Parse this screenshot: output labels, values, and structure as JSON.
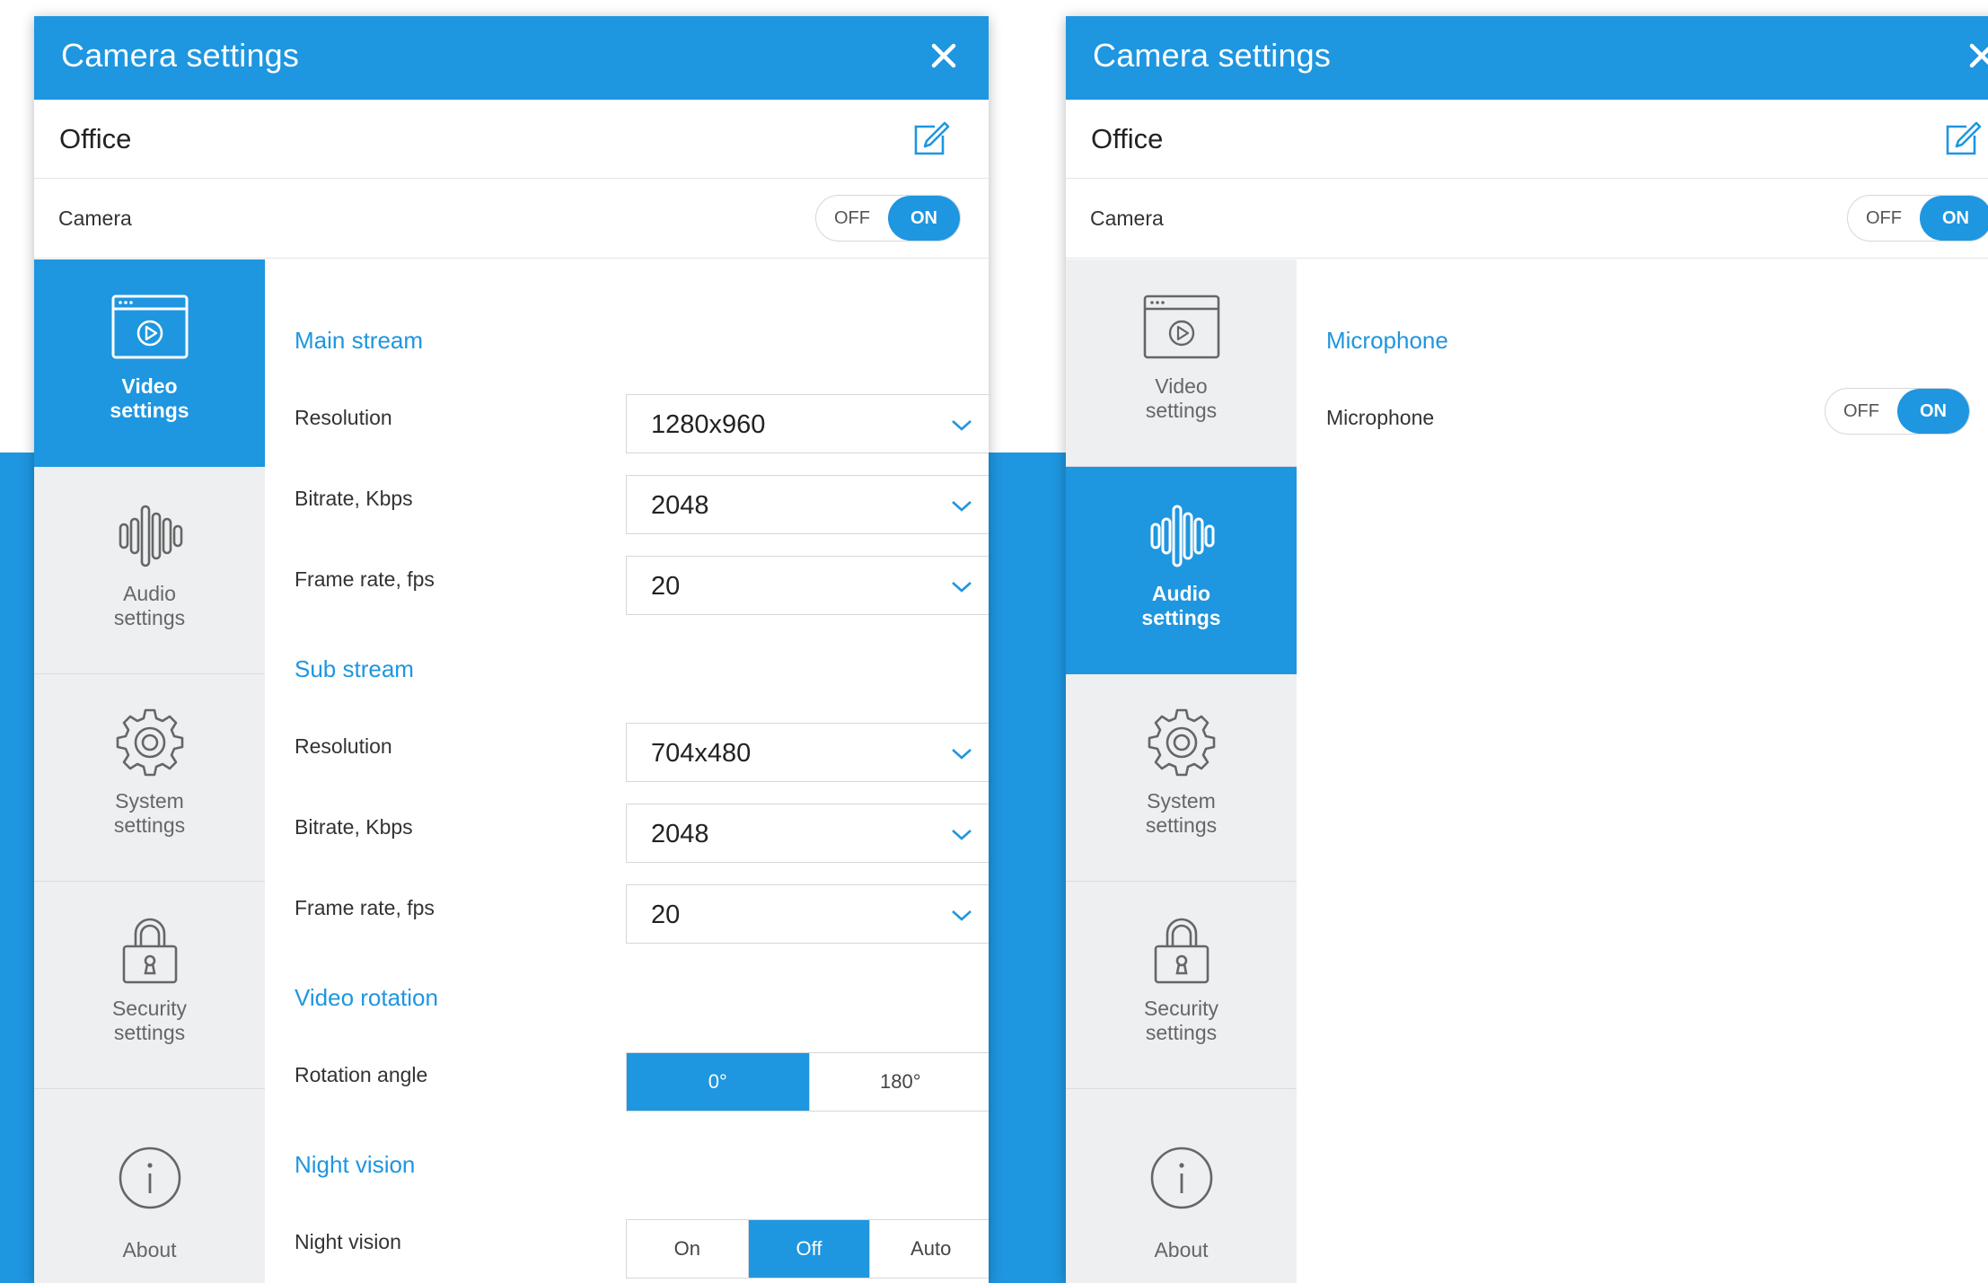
{
  "colors": {
    "accent": "#1e96e0",
    "sidebar_bg": "#eeeff1",
    "divider": "#e2e4e8"
  },
  "left_panel": {
    "title": "Camera settings",
    "device_name": "Office",
    "camera_row": {
      "label": "Camera",
      "toggle_off": "OFF",
      "toggle_on": "ON",
      "state": "ON"
    },
    "sidebar": [
      {
        "label": "Video\nsettings",
        "icon": "video-settings-icon",
        "active": true
      },
      {
        "label": "Audio\nsettings",
        "icon": "audio-waveform-icon",
        "active": false
      },
      {
        "label": "System\nsettings",
        "icon": "gear-icon",
        "active": false
      },
      {
        "label": "Security\nsettings",
        "icon": "lock-icon",
        "active": false
      },
      {
        "label": "About",
        "icon": "info-icon",
        "active": false
      }
    ],
    "main_stream": {
      "title": "Main stream",
      "resolution": {
        "label": "Resolution",
        "value": "1280x960"
      },
      "bitrate": {
        "label": "Bitrate, Kbps",
        "value": "2048"
      },
      "framerate": {
        "label": "Frame rate, fps",
        "value": "20"
      }
    },
    "sub_stream": {
      "title": "Sub stream",
      "resolution": {
        "label": "Resolution",
        "value": "704x480"
      },
      "bitrate": {
        "label": "Bitrate, Kbps",
        "value": "2048"
      },
      "framerate": {
        "label": "Frame rate, fps",
        "value": "20"
      }
    },
    "video_rotation": {
      "title": "Video rotation",
      "label": "Rotation angle",
      "options": [
        "0°",
        "180°"
      ],
      "selected": "0°"
    },
    "night_vision": {
      "title": "Night vision",
      "label": "Night vision",
      "options": [
        "On",
        "Off",
        "Auto"
      ],
      "selected": "Off"
    }
  },
  "right_panel": {
    "title": "Camera settings",
    "device_name": "Office",
    "camera_row": {
      "label": "Camera",
      "toggle_off": "OFF",
      "toggle_on": "ON",
      "state": "ON"
    },
    "sidebar": [
      {
        "label": "Video\nsettings",
        "icon": "video-settings-icon",
        "active": false
      },
      {
        "label": "Audio\nsettings",
        "icon": "audio-waveform-icon",
        "active": true
      },
      {
        "label": "System\nsettings",
        "icon": "gear-icon",
        "active": false
      },
      {
        "label": "Security\nsettings",
        "icon": "lock-icon",
        "active": false
      },
      {
        "label": "About",
        "icon": "info-icon",
        "active": false
      }
    ],
    "microphone": {
      "title": "Microphone",
      "label": "Microphone",
      "toggle_off": "OFF",
      "toggle_on": "ON",
      "state": "ON"
    }
  }
}
